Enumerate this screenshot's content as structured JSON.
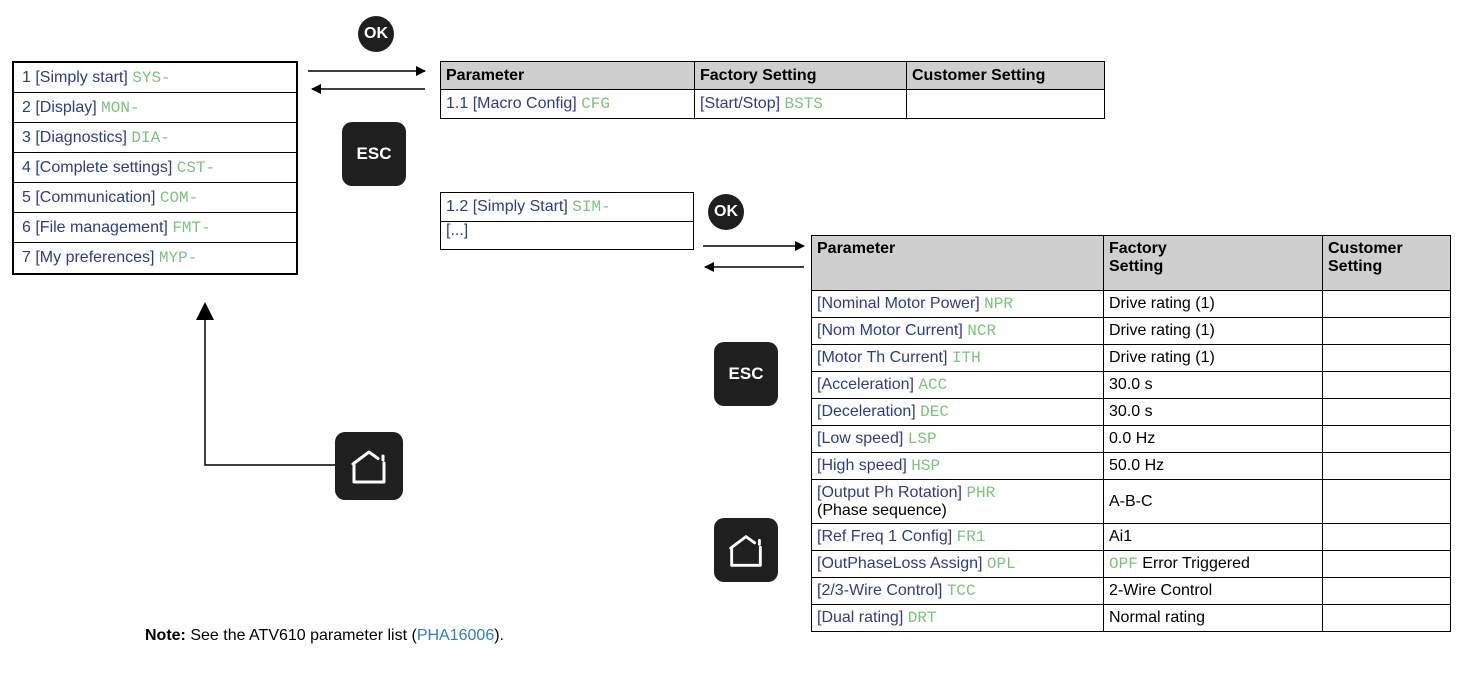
{
  "main_menu": [
    {
      "label": "1 [Simply start]",
      "code": "SYS-"
    },
    {
      "label": "2 [Display]",
      "code": "MON-"
    },
    {
      "label": "3 [Diagnostics]",
      "code": "DIA-"
    },
    {
      "label": "4 [Complete settings]",
      "code": "CST-"
    },
    {
      "label": "5 [Communication]",
      "code": "COM-"
    },
    {
      "label": "6 [File management]",
      "code": "FMT-"
    },
    {
      "label": "7 [My preferences]",
      "code": "MYP-"
    }
  ],
  "keys": {
    "ok": "OK",
    "esc": "ESC"
  },
  "table1": {
    "headers": [
      "Parameter",
      "Factory Setting",
      "Customer Setting"
    ],
    "row": {
      "param_label": "1.1 [Macro Config]",
      "param_code": "CFG",
      "factory_label": "[Start/Stop]",
      "factory_code": "BSTS",
      "customer": ""
    }
  },
  "submenu": [
    {
      "label": "1.2 [Simply Start]",
      "code": "SIM-"
    },
    {
      "label": "[...]",
      "code": ""
    }
  ],
  "table2": {
    "headers": {
      "parameter": "Parameter",
      "factory_line1": "Factory",
      "factory_line2": "Setting",
      "customer_line1": "Customer",
      "customer_line2": "Setting"
    },
    "rows": [
      {
        "label": "[Nominal Motor Power]",
        "code": "NPR",
        "sub": "",
        "factory_code": "",
        "factory": "Drive rating (1)",
        "customer": ""
      },
      {
        "label": "[Nom Motor Current]",
        "code": "NCR",
        "sub": "",
        "factory_code": "",
        "factory": "Drive rating (1)",
        "customer": ""
      },
      {
        "label": "[Motor Th Current]",
        "code": "ITH",
        "sub": "",
        "factory_code": "",
        "factory": "Drive rating (1)",
        "customer": ""
      },
      {
        "label": "[Acceleration]",
        "code": "ACC",
        "sub": "",
        "factory_code": "",
        "factory": "30.0 s",
        "customer": ""
      },
      {
        "label": "[Deceleration]",
        "code": "DEC",
        "sub": "",
        "factory_code": "",
        "factory": "30.0 s",
        "customer": ""
      },
      {
        "label": "[Low speed]",
        "code": "LSP",
        "sub": "",
        "factory_code": "",
        "factory": "0.0 Hz",
        "customer": ""
      },
      {
        "label": "[High speed]",
        "code": "HSP",
        "sub": "",
        "factory_code": "",
        "factory": "50.0 Hz",
        "customer": ""
      },
      {
        "label": "[Output Ph Rotation]",
        "code": "PHR",
        "sub": "(Phase sequence)",
        "factory_code": "",
        "factory": "A-B-C",
        "customer": ""
      },
      {
        "label": "[Ref Freq 1 Config]",
        "code": "FR1",
        "sub": "",
        "factory_code": "",
        "factory": "Ai1",
        "customer": ""
      },
      {
        "label": "[OutPhaseLoss Assign]",
        "code": "OPL",
        "sub": "",
        "factory_code": "OPF",
        "factory": "Error Triggered",
        "customer": ""
      },
      {
        "label": "[2/3-Wire Control]",
        "code": "TCC",
        "sub": "",
        "factory_code": "",
        "factory": "2-Wire Control",
        "customer": ""
      },
      {
        "label": "[Dual rating]",
        "code": "DRT",
        "sub": "",
        "factory_code": "",
        "factory": "Normal rating",
        "customer": ""
      }
    ]
  },
  "note": {
    "prefix": "Note:",
    "text": " See the ATV610 parameter list (",
    "link": "PHA16006",
    "suffix": ")."
  }
}
